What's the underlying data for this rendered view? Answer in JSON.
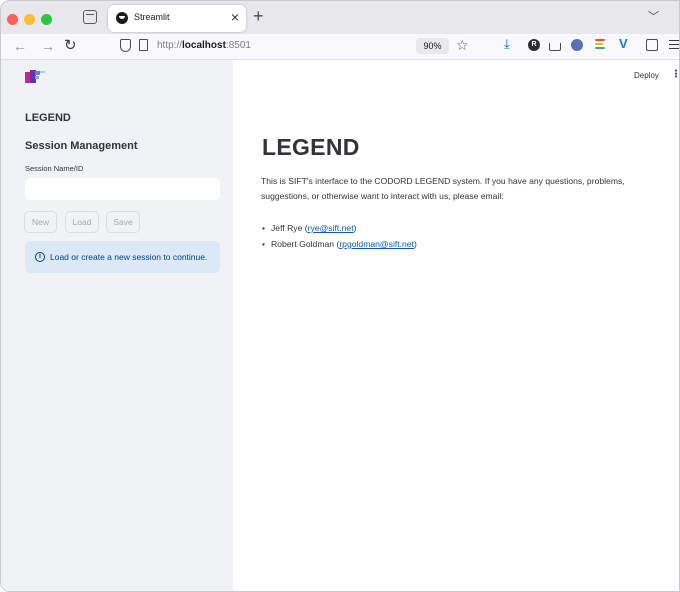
{
  "browser": {
    "tab": {
      "title": "Streamlit"
    },
    "url": {
      "prefix": "http://",
      "host": "localhost",
      "port": ":8501"
    },
    "zoom": "90%"
  },
  "sidebar": {
    "title": "LEGEND",
    "section": "Session Management",
    "session_label": "Session Name/ID",
    "session_value": "",
    "buttons": {
      "new": "New",
      "load": "Load",
      "save": "Save"
    },
    "info": "Load or create a new session to continue."
  },
  "header": {
    "deploy": "Deploy"
  },
  "main": {
    "title": "LEGEND",
    "intro": "This is SIFT's interface to the CODORD LEGEND system. If you have any questions, problems, suggestions, or otherwise want to interact with us, please email:",
    "contacts": [
      {
        "name": "Jeff Rye",
        "email": "rye@sift.net"
      },
      {
        "name": "Robert Goldman",
        "email": "rpgoldman@sift.net"
      }
    ]
  },
  "colors": {
    "info_bg": "#dbe8f6",
    "info_text": "#004280",
    "sidebar_bg": "#f0f2f6",
    "link": "#0b57d0"
  }
}
